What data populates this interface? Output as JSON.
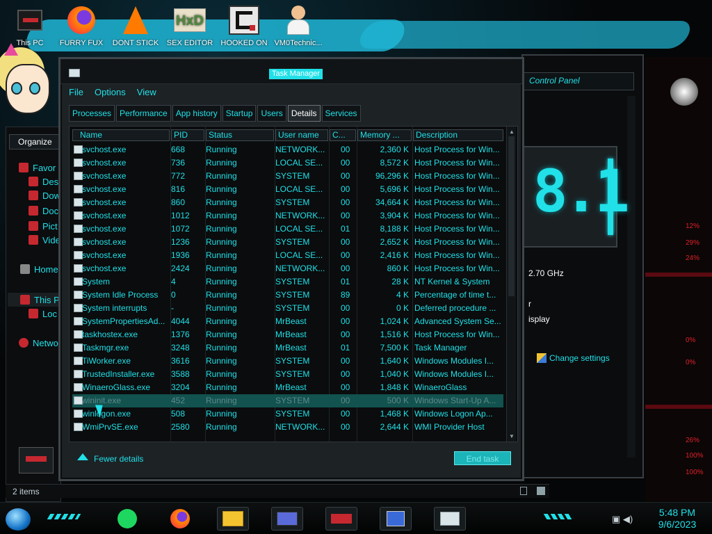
{
  "desktop": {
    "icons": [
      {
        "label": "This PC",
        "icon": "this-pc-icon"
      },
      {
        "label": "FURRY FUX",
        "icon": "firefox-icon"
      },
      {
        "label": "DONT STICK",
        "icon": "vlc-icon"
      },
      {
        "label": "SEX EDITOR",
        "icon": "hxd-editor-icon"
      },
      {
        "label": "HOOKED ON",
        "icon": "game-icon"
      },
      {
        "label": "VM0Technic...",
        "icon": "doctor-icon"
      }
    ]
  },
  "explorer": {
    "organize_label": "Organize",
    "nav": [
      {
        "label": "Favor",
        "icon": "star-icon"
      },
      {
        "label": "Des",
        "icon": "desktop-icon"
      },
      {
        "label": "Dow",
        "icon": "download-icon"
      },
      {
        "label": "Doc",
        "icon": "documents-icon"
      },
      {
        "label": "Pict",
        "icon": "pictures-icon"
      },
      {
        "label": "Vide",
        "icon": "videos-icon"
      },
      {
        "label": "Home",
        "icon": "home-icon"
      },
      {
        "label": "This P",
        "icon": "this-pc-icon"
      },
      {
        "label": "Loc",
        "icon": "drive-icon"
      },
      {
        "label": "Netwo",
        "icon": "network-icon"
      }
    ],
    "status_items": "2 items"
  },
  "control_panel": {
    "title": "Control Panel",
    "version_text": "8.1",
    "cpu_speed": "2.70 GHz",
    "line_r": "r",
    "line_isplay": "isplay",
    "change_settings": "Change settings"
  },
  "task_manager": {
    "title": "Task Manager",
    "menu": [
      "File",
      "Options",
      "View"
    ],
    "tabs": [
      "Processes",
      "Performance",
      "App history",
      "Startup",
      "Users",
      "Details",
      "Services"
    ],
    "active_tab": "Details",
    "columns": [
      "Name",
      "PID",
      "Status",
      "User name",
      "C...",
      "Memory ...",
      "Description"
    ],
    "rows": [
      {
        "name": "svchost.exe",
        "pid": "668",
        "status": "Running",
        "user": "NETWORK...",
        "cpu": "00",
        "mem": "2,360 K",
        "desc": "Host Process for Win..."
      },
      {
        "name": "svchost.exe",
        "pid": "736",
        "status": "Running",
        "user": "LOCAL SE...",
        "cpu": "00",
        "mem": "8,572 K",
        "desc": "Host Process for Win..."
      },
      {
        "name": "svchost.exe",
        "pid": "772",
        "status": "Running",
        "user": "SYSTEM",
        "cpu": "00",
        "mem": "96,296 K",
        "desc": "Host Process for Win..."
      },
      {
        "name": "svchost.exe",
        "pid": "816",
        "status": "Running",
        "user": "LOCAL SE...",
        "cpu": "00",
        "mem": "5,696 K",
        "desc": "Host Process for Win..."
      },
      {
        "name": "svchost.exe",
        "pid": "860",
        "status": "Running",
        "user": "SYSTEM",
        "cpu": "00",
        "mem": "34,664 K",
        "desc": "Host Process for Win..."
      },
      {
        "name": "svchost.exe",
        "pid": "1012",
        "status": "Running",
        "user": "NETWORK...",
        "cpu": "00",
        "mem": "3,904 K",
        "desc": "Host Process for Win..."
      },
      {
        "name": "svchost.exe",
        "pid": "1072",
        "status": "Running",
        "user": "LOCAL SE...",
        "cpu": "01",
        "mem": "8,188 K",
        "desc": "Host Process for Win..."
      },
      {
        "name": "svchost.exe",
        "pid": "1236",
        "status": "Running",
        "user": "SYSTEM",
        "cpu": "00",
        "mem": "2,652 K",
        "desc": "Host Process for Win..."
      },
      {
        "name": "svchost.exe",
        "pid": "1936",
        "status": "Running",
        "user": "LOCAL SE...",
        "cpu": "00",
        "mem": "2,416 K",
        "desc": "Host Process for Win..."
      },
      {
        "name": "svchost.exe",
        "pid": "2424",
        "status": "Running",
        "user": "NETWORK...",
        "cpu": "00",
        "mem": "860 K",
        "desc": "Host Process for Win..."
      },
      {
        "name": "System",
        "pid": "4",
        "status": "Running",
        "user": "SYSTEM",
        "cpu": "01",
        "mem": "28 K",
        "desc": "NT Kernel & System"
      },
      {
        "name": "System Idle Process",
        "pid": "0",
        "status": "Running",
        "user": "SYSTEM",
        "cpu": "89",
        "mem": "4 K",
        "desc": "Percentage of time t..."
      },
      {
        "name": "System interrupts",
        "pid": "-",
        "status": "Running",
        "user": "SYSTEM",
        "cpu": "00",
        "mem": "0 K",
        "desc": "Deferred procedure ..."
      },
      {
        "name": "SystemPropertiesAd...",
        "pid": "4044",
        "status": "Running",
        "user": "MrBeast",
        "cpu": "00",
        "mem": "1,024 K",
        "desc": "Advanced System Se..."
      },
      {
        "name": "taskhostex.exe",
        "pid": "1376",
        "status": "Running",
        "user": "MrBeast",
        "cpu": "00",
        "mem": "1,516 K",
        "desc": "Host Process for Win..."
      },
      {
        "name": "Taskmgr.exe",
        "pid": "3248",
        "status": "Running",
        "user": "MrBeast",
        "cpu": "01",
        "mem": "7,500 K",
        "desc": "Task Manager"
      },
      {
        "name": "TiWorker.exe",
        "pid": "3616",
        "status": "Running",
        "user": "SYSTEM",
        "cpu": "00",
        "mem": "1,640 K",
        "desc": "Windows Modules I..."
      },
      {
        "name": "TrustedInstaller.exe",
        "pid": "3588",
        "status": "Running",
        "user": "SYSTEM",
        "cpu": "00",
        "mem": "1,040 K",
        "desc": "Windows Modules I..."
      },
      {
        "name": "WinaeroGlass.exe",
        "pid": "3204",
        "status": "Running",
        "user": "MrBeast",
        "cpu": "00",
        "mem": "1,848 K",
        "desc": "WinaeroGlass"
      },
      {
        "name": "wininit.exe",
        "pid": "452",
        "status": "Running",
        "user": "SYSTEM",
        "cpu": "00",
        "mem": "500 K",
        "desc": "Windows Start-Up A...",
        "selected": true
      },
      {
        "name": "winlogon.exe",
        "pid": "508",
        "status": "Running",
        "user": "SYSTEM",
        "cpu": "00",
        "mem": "1,468 K",
        "desc": "Windows Logon Ap..."
      },
      {
        "name": "WmiPrvSE.exe",
        "pid": "2580",
        "status": "Running",
        "user": "NETWORK...",
        "cpu": "00",
        "mem": "2,644 K",
        "desc": "WMI Provider Host"
      }
    ],
    "fewer_details": "Fewer details",
    "end_task": "End task"
  },
  "right_gauges": [
    "12%",
    "29%",
    "24%",
    "0%",
    "0%",
    "26%",
    "100%",
    "100%"
  ],
  "taskbar": {
    "time": "5:48 PM",
    "date": "9/6/2023",
    "apps": [
      "spotify-icon",
      "firefox-icon",
      "file-explorer-icon",
      "control-panel-icon",
      "alienware-icon",
      "system-icon",
      "task-manager-icon"
    ]
  },
  "colors": {
    "accent": "#21e0e8",
    "selection": "#12524f",
    "alert": "#e0202a"
  }
}
